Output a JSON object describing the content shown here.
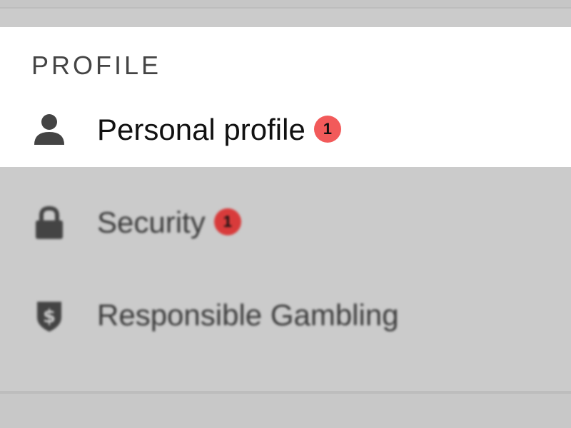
{
  "menu": {
    "section_title": "PROFILE",
    "items": [
      {
        "label": "Personal profile",
        "badge": "1",
        "icon": "person-icon",
        "active": true
      },
      {
        "label": "Security",
        "badge": "1",
        "icon": "lock-icon",
        "active": false
      },
      {
        "label": "Responsible Gambling",
        "badge": "",
        "icon": "shield-dollar-icon",
        "active": false
      }
    ]
  },
  "colors": {
    "active_panel_bg": "#ffffff",
    "overlay_bg": "#cbcbcb",
    "badge_red": "#f25a5a",
    "text_dark": "#111111",
    "icon_dark": "#444444"
  }
}
